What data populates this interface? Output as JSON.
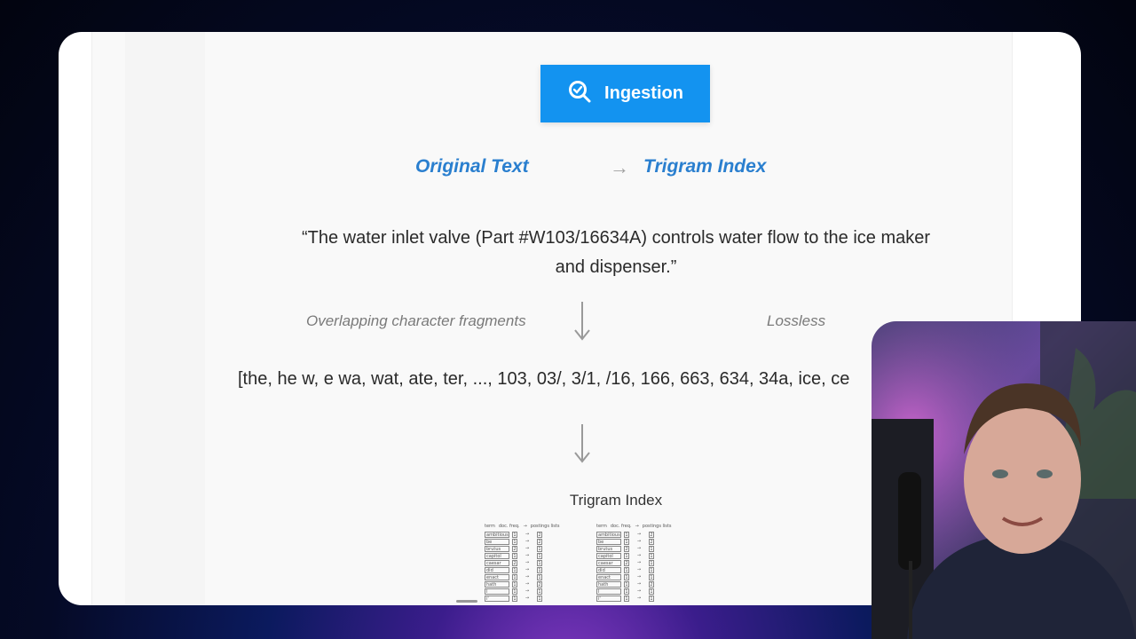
{
  "slide": {
    "button_label": "Ingestion",
    "button_icon": "search-check-icon",
    "left_heading": "Original Text",
    "arrow": "→",
    "right_heading": "Trigram Index",
    "quote_line1": "“The water inlet valve (Part #W103/16634A) controls water flow to the ice maker",
    "quote_line2": "and dispenser.”",
    "left_note": "Overlapping character fragments",
    "right_note": "Lossless",
    "trigrams": "[the, he w, e wa,  wat, ate, ter, ..., 103, 03/, 3/1, /16, 166, 663, 634, 34a, ice, ce",
    "index_title": "Trigram Index"
  },
  "index_tables": [
    {
      "headers": [
        "term",
        "doc. freq.",
        "→",
        "postings lists"
      ],
      "rows": [
        {
          "term": "ambitious",
          "freq": "1",
          "posting": "2"
        },
        {
          "term": "be",
          "freq": "1",
          "posting": "2"
        },
        {
          "term": "brutus",
          "freq": "2",
          "posting": "1"
        },
        {
          "term": "capitol",
          "freq": "1",
          "posting": "1"
        },
        {
          "term": "caesar",
          "freq": "2",
          "posting": "1"
        },
        {
          "term": "did",
          "freq": "1",
          "posting": "1"
        },
        {
          "term": "enact",
          "freq": "1",
          "posting": "1"
        },
        {
          "term": "hath",
          "freq": "1",
          "posting": "2"
        },
        {
          "term": "I",
          "freq": "1",
          "posting": "1"
        },
        {
          "term": "i'",
          "freq": "1",
          "posting": "1"
        }
      ]
    },
    {
      "headers": [
        "term",
        "doc. freq.",
        "→",
        "postings lists"
      ],
      "rows": [
        {
          "term": "ambitious",
          "freq": "1",
          "posting": "2"
        },
        {
          "term": "be",
          "freq": "1",
          "posting": "2"
        },
        {
          "term": "brutus",
          "freq": "2",
          "posting": "1"
        },
        {
          "term": "capitol",
          "freq": "1",
          "posting": "1"
        },
        {
          "term": "caesar",
          "freq": "2",
          "posting": "1"
        },
        {
          "term": "did",
          "freq": "1",
          "posting": "1"
        },
        {
          "term": "enact",
          "freq": "1",
          "posting": "1"
        },
        {
          "term": "hath",
          "freq": "1",
          "posting": "2"
        },
        {
          "term": "I",
          "freq": "1",
          "posting": "1"
        },
        {
          "term": "i'",
          "freq": "1",
          "posting": "1"
        }
      ]
    }
  ],
  "colors": {
    "button_bg": "#1393f0",
    "heading": "#2a7fcf",
    "body_text": "#2a2a2a"
  }
}
